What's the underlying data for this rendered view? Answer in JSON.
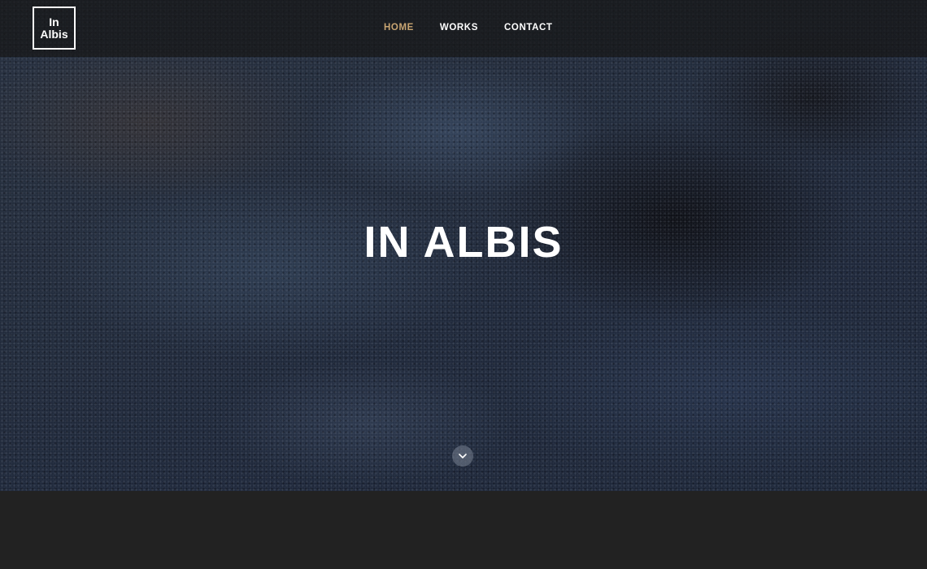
{
  "brand": {
    "logo_line1": "In",
    "logo_line2": "Albis"
  },
  "nav": {
    "items": [
      {
        "label": "HOME",
        "active": true
      },
      {
        "label": "WORKS",
        "active": false
      },
      {
        "label": "CONTACT",
        "active": false
      }
    ],
    "active_color": "#c8a572"
  },
  "hero": {
    "title": "IN ALBIS",
    "scroll_icon": "chevron-down-icon"
  }
}
